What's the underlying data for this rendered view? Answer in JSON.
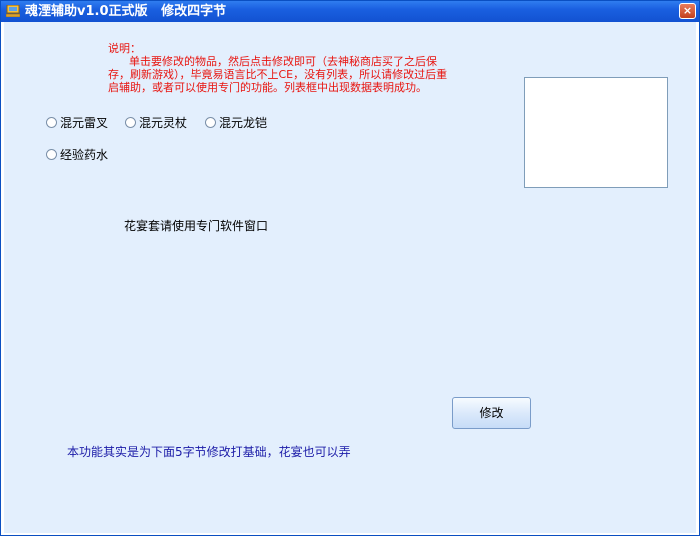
{
  "window": {
    "title": "魂湮辅助v1.0正式版   修改四字节",
    "close_label": "×"
  },
  "description": {
    "lines": [
      "说明：",
      "      单击要修改的物品，然后点击修改即可（去神秘商店买了之后保",
      "存，刷新游戏），毕竟易语言比不上CE，没有列表，所以请修改过后重",
      "启辅助，或者可以使用专门的功能。列表框中出现数据表明成功。"
    ]
  },
  "radios": [
    {
      "label": "混元雷叉",
      "checked": false
    },
    {
      "label": "混元灵杖",
      "checked": false
    },
    {
      "label": "混元龙铠",
      "checked": false
    },
    {
      "label": "经验药水",
      "checked": false
    }
  ],
  "listbox": {
    "items": []
  },
  "note_top": "花宴套请使用专门软件窗口",
  "modify_button": "修改",
  "note_bottom": "本功能其实是为下面5字节修改打基础，花宴也可以弄",
  "colors": {
    "titlebar": "#1a5fe0",
    "client_bg": "#e3effd",
    "description_text": "#e8140f",
    "bottom_note_text": "#1c1ca8"
  }
}
